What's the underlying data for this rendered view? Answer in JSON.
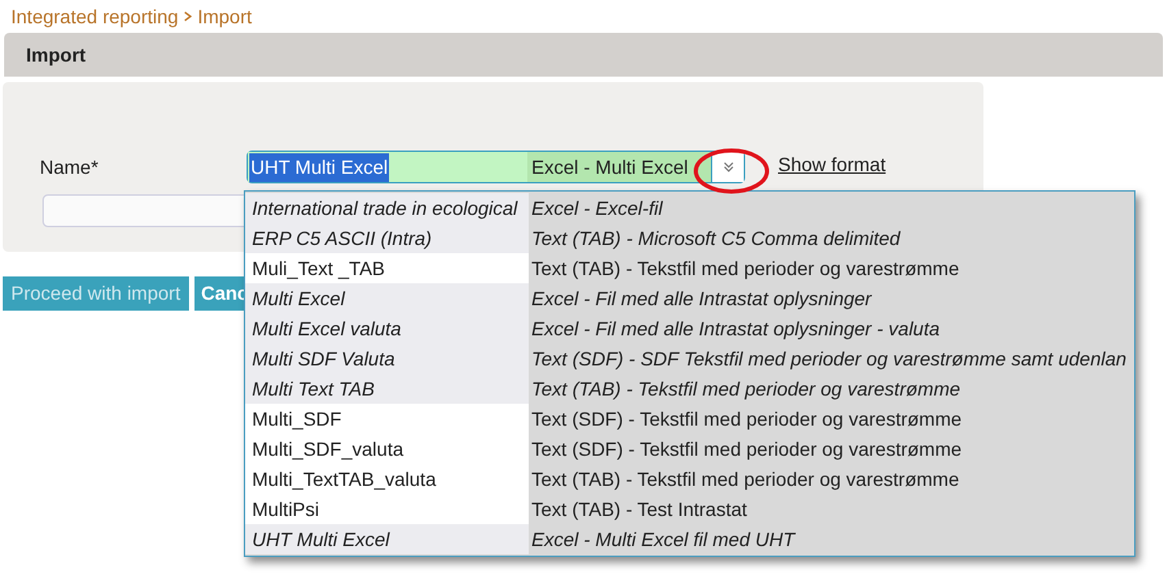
{
  "breadcrumb": [
    "Integrated reporting",
    "Import"
  ],
  "header": {
    "title": "Import"
  },
  "form": {
    "label": "Name*",
    "combo": {
      "value": "UHT Multi Excel",
      "format": "Excel - Multi Excel"
    },
    "link": "Show format"
  },
  "options": [
    {
      "name": "International trade in ecological",
      "format": "Excel - Excel-fil",
      "emphasized": true
    },
    {
      "name": "ERP C5 ASCII (Intra)",
      "format": "Text (TAB) - Microsoft C5 Comma delimited",
      "emphasized": true
    },
    {
      "name": "Muli_Text _TAB",
      "format": "Text (TAB) - Tekstfil med perioder og varestrømme",
      "emphasized": false
    },
    {
      "name": "Multi Excel",
      "format": "Excel - Fil med alle Intrastat oplysninger",
      "emphasized": true
    },
    {
      "name": "Multi Excel valuta",
      "format": "Excel - Fil med alle Intrastat oplysninger - valuta",
      "emphasized": true
    },
    {
      "name": "Multi SDF Valuta",
      "format": "Text (SDF) - SDF Tekstfil med perioder og varestrømme samt udenlan",
      "emphasized": true
    },
    {
      "name": "Multi Text TAB",
      "format": "Text (TAB) - Tekstfil med perioder og varestrømme",
      "emphasized": true
    },
    {
      "name": "Multi_SDF",
      "format": "Text (SDF) - Tekstfil med perioder og varestrømme",
      "emphasized": false
    },
    {
      "name": "Multi_SDF_valuta",
      "format": "Text (SDF) - Tekstfil med perioder og varestrømme",
      "emphasized": false
    },
    {
      "name": "Multi_TextTAB_valuta",
      "format": "Text (TAB) - Tekstfil med perioder og varestrømme",
      "emphasized": false
    },
    {
      "name": "MultiPsi",
      "format": "Text (TAB) - Test Intrastat",
      "emphasized": false
    },
    {
      "name": "UHT Multi Excel",
      "format": "Excel - Multi Excel fil med UHT",
      "emphasized": true
    }
  ],
  "buttons": [
    "Proceed with import",
    "Canc"
  ]
}
